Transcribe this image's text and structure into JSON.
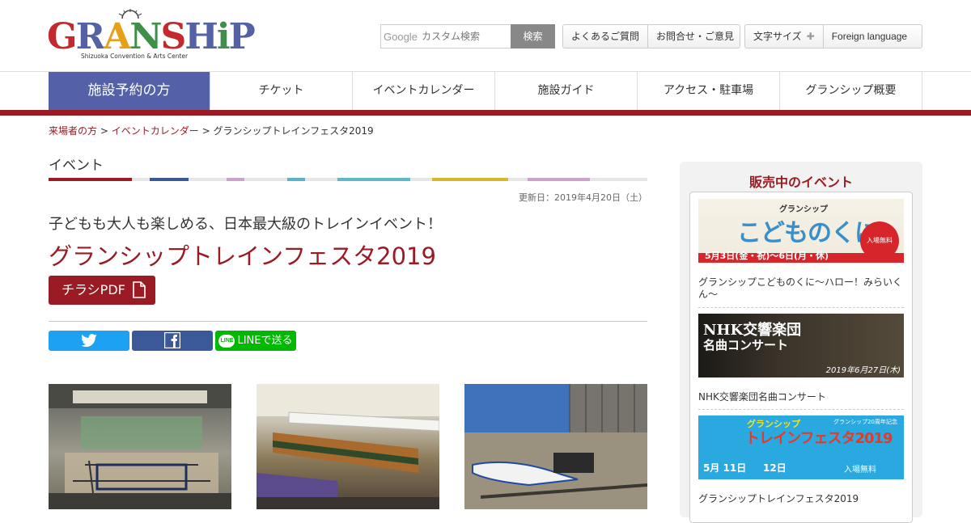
{
  "header": {
    "logo_text": "GRANSHIP",
    "logo_sub": "Shizuoka Convention & Arts Center",
    "search_google": "Google",
    "search_placeholder": "カスタム検索",
    "search_button": "検索",
    "links": [
      "よくあるご質問",
      "お問合せ・ご意見"
    ],
    "font_size_label": "文字サイズ",
    "foreign_label": "Foreign language"
  },
  "nav": {
    "items": [
      "施設予約の方",
      "チケット",
      "イベントカレンダー",
      "施設ガイド",
      "アクセス・駐車場",
      "グランシップ概要"
    ],
    "active_color": "#5461a8",
    "bar_color": "#9a1b23"
  },
  "breadcrumb": {
    "items": [
      "来場者の方",
      "イベントカレンダー"
    ],
    "current": "グランシップトレインフェスタ2019",
    "sep": ">"
  },
  "main": {
    "section_title": "イベント",
    "color_bar": [
      "#9a1b23",
      "#e6e6e6",
      "#3b5998",
      "#e6e6e6",
      "#c9a3c9",
      "#e6e6e6",
      "#5ab3c4",
      "#e6e6e6",
      "#5fb8c3",
      "#e6e6e6",
      "#d5b82a",
      "#e6e6e6",
      "#c9a3c9"
    ],
    "updated": "更新日：2019年4月20日（土）",
    "lead": "子どもも大人も楽しめる、日本最大級のトレインイベント！",
    "title": "グランシップトレインフェスタ2019",
    "pdf_label": "チラシPDF",
    "share_line": "LINEで送る"
  },
  "sidebar": {
    "title": "販売中のイベント",
    "items": [
      {
        "caption": "グランシップこどものくに～ハロー！みらいくん～",
        "banner_top": "グランシップ",
        "banner_main": "こどものくに",
        "banner_badge": "入場無料",
        "banner_date": "5月3日(金・祝)～6日(月・休)"
      },
      {
        "caption": "NHK交響楽団名曲コンサート",
        "banner_main": "NHK交響楽団",
        "banner_sub": "名曲コンサート",
        "banner_date": "2019年6月27日(木)"
      },
      {
        "caption": "グランシップトレインフェスタ2019",
        "banner_main": "グランシップ",
        "banner_sub": "トレインフェスタ2019",
        "banner_badge": "入場無料",
        "banner_note": "グランシップ20周年記念",
        "banner_date1": "5月 11日",
        "banner_date2": "12日"
      }
    ]
  }
}
